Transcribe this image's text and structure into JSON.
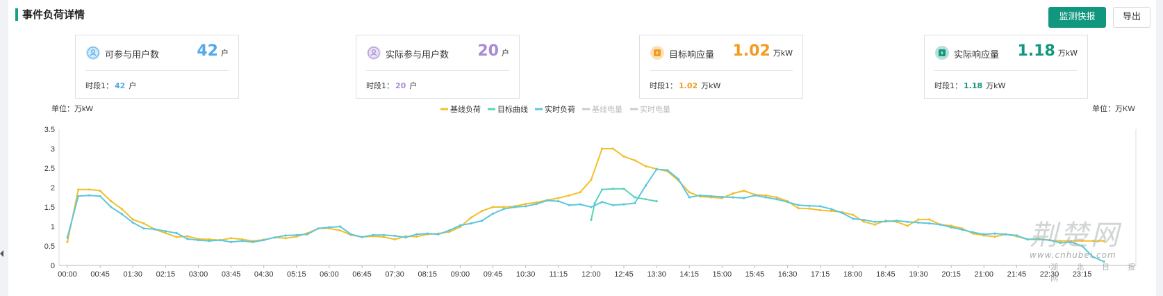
{
  "header": {
    "title": "事件负荷详情",
    "report_btn": "监测快报",
    "export_btn": "导出"
  },
  "colors": {
    "accent": "#12977f",
    "blue": "#53a9e9",
    "purple": "#a98ad6",
    "orange": "#f29b1c",
    "teal": "#12977f",
    "baseline": "#f2bf2b",
    "target": "#57d3b9",
    "realtime": "#5bc7dd",
    "inactive": "#cccccc"
  },
  "cards": [
    {
      "label": "可参与用户数",
      "value": "42",
      "unit": "户",
      "sub_label": "时段1：",
      "sub_value": "42",
      "sub_unit": "户",
      "color": "#53a9e9",
      "icon": "user-icon"
    },
    {
      "label": "实际参与用户数",
      "value": "20",
      "unit": "户",
      "sub_label": "时段1：",
      "sub_value": "20",
      "sub_unit": "户",
      "color": "#a98ad6",
      "icon": "user-icon"
    },
    {
      "label": "目标响应量",
      "value": "1.02",
      "unit": "万kW",
      "sub_label": "时段1：",
      "sub_value": "1.02",
      "sub_unit": "万kW",
      "color": "#f29b1c",
      "icon": "energy-icon"
    },
    {
      "label": "实际响应量",
      "value": "1.18",
      "unit": "万kW",
      "sub_label": "时段1：",
      "sub_value": "1.18",
      "sub_unit": "万kW",
      "color": "#12977f",
      "icon": "energy-icon"
    }
  ],
  "watermark": {
    "main": "荆楚网",
    "url": "www.cnhubei.com",
    "cn": "湖北日报网"
  },
  "chart_data": {
    "type": "line",
    "ylabel_left": "单位：万kW",
    "ylabel_right": "单位：万KW",
    "ylim": [
      0,
      3.5
    ],
    "yticks": [
      "0",
      "0.5",
      "1",
      "1.5",
      "2",
      "2.5",
      "3",
      "3.5"
    ],
    "xticks": [
      "00:00",
      "00:45",
      "01:30",
      "02:15",
      "03:00",
      "03:45",
      "04:30",
      "05:15",
      "06:00",
      "06:45",
      "07:30",
      "08:15",
      "09:00",
      "09:45",
      "10:30",
      "11:15",
      "12:00",
      "12:45",
      "13:30",
      "14:15",
      "15:00",
      "15:45",
      "16:30",
      "17:15",
      "18:00",
      "18:45",
      "19:30",
      "20:15",
      "21:00",
      "21:45",
      "22:30",
      "23:15"
    ],
    "x_range_minutes": [
      0,
      1425
    ],
    "legend": [
      {
        "name": "基线负荷",
        "active": true
      },
      {
        "name": "目标曲线",
        "active": true
      },
      {
        "name": "实时负荷",
        "active": true
      },
      {
        "name": "基线电量",
        "active": false
      },
      {
        "name": "实时电量",
        "active": false
      }
    ],
    "legend_position": "top-center",
    "series": [
      {
        "name": "基线负荷",
        "x": [
          0,
          15,
          30,
          45,
          60,
          75,
          90,
          105,
          120,
          135,
          150,
          165,
          180,
          195,
          210,
          225,
          240,
          255,
          270,
          285,
          300,
          315,
          330,
          345,
          360,
          375,
          390,
          405,
          420,
          435,
          450,
          465,
          480,
          495,
          510,
          525,
          540,
          555,
          570,
          585,
          600,
          615,
          630,
          645,
          660,
          675,
          690,
          705,
          720,
          735,
          750,
          765,
          780,
          795,
          810,
          825,
          840,
          855,
          870,
          885,
          900,
          915,
          930,
          945,
          960,
          975,
          990,
          1005,
          1020,
          1035,
          1050,
          1065,
          1080,
          1095,
          1110,
          1125,
          1140,
          1155,
          1170,
          1185,
          1200,
          1215,
          1230,
          1245,
          1260,
          1275,
          1290,
          1305,
          1320,
          1335,
          1350,
          1365,
          1380,
          1395,
          1410,
          1425
        ],
        "y": [
          0.6,
          1.95,
          1.95,
          1.92,
          1.65,
          1.45,
          1.18,
          1.08,
          0.93,
          0.83,
          0.73,
          0.75,
          0.68,
          0.67,
          0.65,
          0.7,
          0.67,
          0.63,
          0.66,
          0.72,
          0.7,
          0.74,
          0.83,
          0.95,
          0.95,
          0.9,
          0.78,
          0.73,
          0.75,
          0.73,
          0.67,
          0.75,
          0.74,
          0.8,
          0.82,
          0.86,
          0.99,
          1.23,
          1.4,
          1.5,
          1.5,
          1.52,
          1.58,
          1.62,
          1.68,
          1.73,
          1.8,
          1.88,
          2.2,
          3.0,
          3.0,
          2.8,
          2.7,
          2.55,
          2.48,
          2.42,
          2.18,
          1.88,
          1.77,
          1.75,
          1.73,
          1.85,
          1.92,
          1.82,
          1.8,
          1.75,
          1.65,
          1.47,
          1.46,
          1.42,
          1.4,
          1.37,
          1.3,
          1.12,
          1.05,
          1.15,
          1.12,
          1.02,
          1.18,
          1.18,
          1.05,
          1.02,
          0.95,
          0.82,
          0.77,
          0.74,
          0.8,
          0.75,
          0.67,
          0.69,
          0.65,
          0.63,
          0.63,
          0.63,
          0.63,
          0.63
        ]
      },
      {
        "name": "目标曲线",
        "x": [
          720,
          725,
          735,
          750,
          765,
          780,
          795,
          810
        ],
        "y": [
          1.17,
          1.6,
          1.95,
          1.97,
          1.97,
          1.75,
          1.7,
          1.65
        ]
      },
      {
        "name": "实时负荷",
        "x": [
          0,
          15,
          30,
          45,
          60,
          75,
          90,
          105,
          120,
          135,
          150,
          165,
          180,
          195,
          210,
          225,
          240,
          255,
          270,
          285,
          300,
          315,
          330,
          345,
          360,
          375,
          390,
          405,
          420,
          435,
          450,
          465,
          480,
          495,
          510,
          525,
          540,
          555,
          570,
          585,
          600,
          615,
          630,
          645,
          660,
          675,
          690,
          705,
          720,
          735,
          750,
          765,
          780,
          795,
          810,
          825,
          840,
          855,
          870,
          885,
          900,
          915,
          930,
          945,
          960,
          975,
          990,
          1005,
          1020,
          1035,
          1050,
          1065,
          1080,
          1095,
          1110,
          1125,
          1140,
          1155,
          1170,
          1185,
          1200,
          1215,
          1230,
          1245,
          1260,
          1275,
          1290,
          1305,
          1320,
          1335,
          1350,
          1365,
          1380,
          1395,
          1410,
          1425
        ],
        "y": [
          0.72,
          1.78,
          1.8,
          1.78,
          1.5,
          1.32,
          1.1,
          0.95,
          0.93,
          0.88,
          0.83,
          0.68,
          0.65,
          0.63,
          0.65,
          0.6,
          0.63,
          0.6,
          0.65,
          0.72,
          0.77,
          0.78,
          0.8,
          0.95,
          0.98,
          1.0,
          0.8,
          0.73,
          0.78,
          0.78,
          0.76,
          0.72,
          0.8,
          0.82,
          0.8,
          0.9,
          1.03,
          1.08,
          1.15,
          1.33,
          1.45,
          1.5,
          1.52,
          1.58,
          1.67,
          1.65,
          1.55,
          1.57,
          1.5,
          1.63,
          1.55,
          1.57,
          1.6,
          2.05,
          2.47,
          2.45,
          2.22,
          1.75,
          1.8,
          1.78,
          1.76,
          1.75,
          1.73,
          1.8,
          1.75,
          1.7,
          1.63,
          1.55,
          1.53,
          1.52,
          1.45,
          1.35,
          1.2,
          1.17,
          1.12,
          1.13,
          1.15,
          1.12,
          1.1,
          1.08,
          1.05,
          0.98,
          0.92,
          0.85,
          0.8,
          0.82,
          0.8,
          0.77,
          0.67,
          0.67,
          0.65,
          0.58,
          0.6,
          0.5,
          0.22,
          0.1
        ]
      }
    ]
  }
}
